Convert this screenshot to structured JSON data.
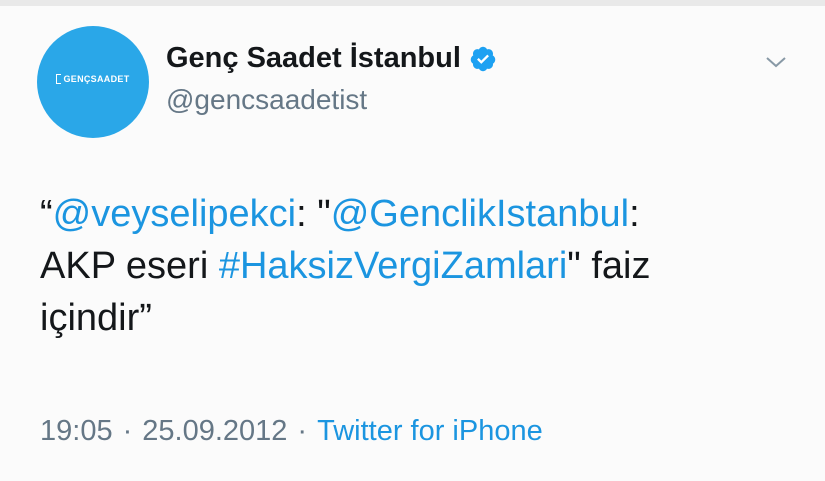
{
  "avatar": {
    "logo_text": "GENÇSAADET",
    "color": "#2aa7e8"
  },
  "user": {
    "display_name": "Genç Saadet İstanbul",
    "handle": "@gencsaadetist",
    "verified": true,
    "verified_icon": "verified-badge-icon"
  },
  "menu_icon": "chevron-down-icon",
  "tweet": {
    "open_quote": "“",
    "mention1": "@veyselipekci",
    "t1": ": \"",
    "mention2": "@GenclikIstanbul",
    "t2": ":",
    "t3": "AKP eseri ",
    "hashtag": "#HaksizVergiZamlari",
    "t4": "\" faiz",
    "t5": "içindir",
    "close_quote": "”"
  },
  "meta": {
    "time": "19:05",
    "date": "25.09.2012",
    "separator": "·",
    "source": "Twitter for iPhone"
  },
  "colors": {
    "link": "#1b95e0",
    "text": "#14171a",
    "muted": "#657786"
  }
}
